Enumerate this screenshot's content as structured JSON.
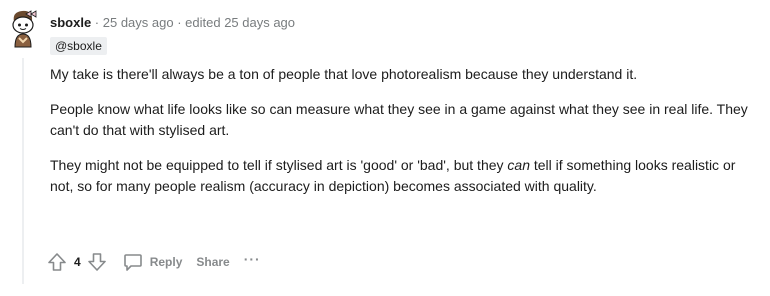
{
  "comment": {
    "author": "sboxle",
    "sep1": " · ",
    "age": "25 days ago",
    "sep2": " · ",
    "edited": "edited 25 days ago",
    "flair": "@sboxle",
    "avatar_icon": "snoo-avatar-icon",
    "paragraphs": {
      "p1": "My take is there'll always be a ton of people that love photorealism because they understand it.",
      "p2": "People know what life looks like so can measure what they see in a game against what they see in real life. They can't do that with stylised art.",
      "p3_before": "They might not be equipped to tell if stylised art is 'good' or 'bad', but they ",
      "p3_em": "can",
      "p3_after": " tell if something looks realistic or not, so for many people realism (accuracy in depiction) becomes associated with quality."
    }
  },
  "actions": {
    "upvote_icon": "upvote-arrow-icon",
    "score": "4",
    "downvote_icon": "downvote-arrow-icon",
    "reply_icon": "speech-bubble-icon",
    "reply_label": "Reply",
    "share_label": "Share",
    "more_label": "···"
  },
  "colors": {
    "meta_text": "#787c7e",
    "action_text": "#878a8c",
    "body_text": "#1c1c1c",
    "flair_bg": "#edeff1"
  }
}
